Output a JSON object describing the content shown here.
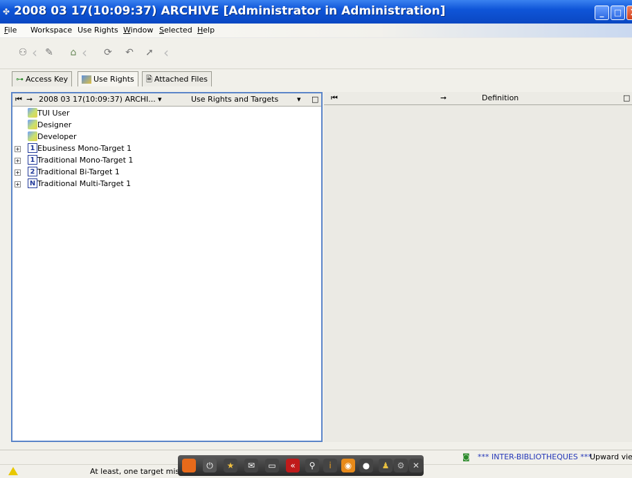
{
  "window": {
    "title": "2008 03 17(10:09:37) ARCHIVE [Administrator in Administration]",
    "buttons": {
      "minimize": "_",
      "maximize": "□",
      "close": "X"
    }
  },
  "menu": [
    {
      "pre": "",
      "u": "F",
      "post": "ile"
    },
    {
      "pre": "Workspace",
      "u": "",
      "post": ""
    },
    {
      "pre": "Use Rights",
      "u": "",
      "post": ""
    },
    {
      "pre": "",
      "u": "W",
      "post": "indow"
    },
    {
      "pre": "",
      "u": "S",
      "post": "elected"
    },
    {
      "pre": "",
      "u": "H",
      "post": "elp"
    }
  ],
  "toolbar": {
    "icons": [
      "users-icon",
      "pin-icon",
      "home-icon",
      "refresh-icon",
      "undo-icon",
      "export-icon"
    ]
  },
  "tabs": [
    {
      "label": "Access Key",
      "icon": "key-icon"
    },
    {
      "label": "Use Rights",
      "icon": "use-rights-icon"
    },
    {
      "label": "Attached Files",
      "icon": "file-icon"
    }
  ],
  "left_panel": {
    "nav_glyph": "⏮",
    "arrow": "➞",
    "breadcrumb": "2008 03 17(10:09:37) ARCHI...",
    "column": "Use Rights and Targets",
    "dropdown": "▾",
    "maximize": "□"
  },
  "tree": [
    {
      "label": "TUI User",
      "type": "user",
      "expandable": false
    },
    {
      "label": "Designer",
      "type": "user",
      "expandable": false
    },
    {
      "label": "Developer",
      "type": "user",
      "expandable": false
    },
    {
      "label": "Ebusiness Mono-Target 1",
      "type": "target",
      "badge": "1",
      "expandable": true
    },
    {
      "label": "Traditional Mono-Target 1",
      "type": "target",
      "badge": "1",
      "expandable": true
    },
    {
      "label": "Traditional Bi-Target 1",
      "type": "target",
      "badge": "2",
      "expandable": true
    },
    {
      "label": "Traditional Multi-Target 1",
      "type": "target",
      "badge": "N",
      "expandable": true
    }
  ],
  "right_panel": {
    "nav_glyph": "⏮",
    "arrow": "➞",
    "column": "Definition",
    "maximize": "□"
  },
  "status": {
    "message": "At least, one target missing",
    "workspace": "*** INTER-BIBLIOTHEQUES ***",
    "mode": "Upward view"
  },
  "colors": {
    "title_bar": "#0f55d8",
    "panel_border": "#5a84c8",
    "status_blue": "#2336b8"
  }
}
